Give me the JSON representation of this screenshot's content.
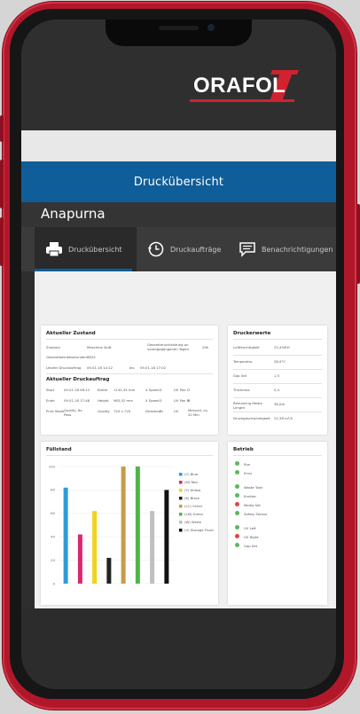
{
  "app": {
    "logo_text": "ORAFOL",
    "banner_title": "Druckübersicht",
    "machine_name": "Anapurna",
    "colors": {
      "banner": "#0f5d99",
      "logo_accent": "#d1222f",
      "phone_frame": "#b0182a"
    }
  },
  "tabs": [
    {
      "label": "Druckübersicht",
      "icon": "printer-icon",
      "active": true
    },
    {
      "label": "Druckaufträge",
      "icon": "history-clock-icon",
      "active": false
    },
    {
      "label": "Benachrichtigungen",
      "icon": "message-icon",
      "active": false
    }
  ],
  "status_card": {
    "title": "Aktueller Zustand",
    "rows": [
      {
        "label": "Zustand",
        "value": "Maschine läuft",
        "note": "Gesamtdruckleistung an vorangegangenen Tagen",
        "extra": "29h"
      },
      {
        "label": "Gesamtbetriebsstunden",
        "value": "8824"
      },
      {
        "label": "Letzter Druckauftrag",
        "value": "09.01.18 14:12",
        "mid": "bis",
        "value2": "09.01.18 17:02"
      }
    ],
    "job_title": "Aktueller Druckauftrag",
    "job_rows": [
      [
        "Start",
        "09.01.18 08:12",
        "Breite",
        "1142,34 mm",
        "X Speed",
        "4",
        "UV Pwr L",
        "7"
      ],
      [
        "Ende",
        "09.01.18 17:48",
        "Height",
        "963,02 mm",
        "X Speed",
        "3",
        "UV Pwr R",
        "6"
      ],
      [
        "Print Mode",
        "Quality, 8x Pass",
        "Quality",
        "720 x 720",
        "Direction",
        "Bi",
        "UV",
        "Manuell, ca. 20 Min"
      ]
    ]
  },
  "values_card": {
    "title": "Druckerwerte",
    "rows": [
      {
        "label": "Luftfeuchtigkeit",
        "value": "25,4%RH"
      },
      {
        "label": "Temperatur",
        "value": "28,9°C"
      },
      {
        "label": "Gap Set",
        "value": "1,5"
      },
      {
        "label": "Thickness",
        "value": "0,4"
      },
      {
        "label": "Remaining Media Length",
        "value": "36,0m"
      },
      {
        "label": "Druckgeschwindigkeit",
        "value": "22,38 m²/h"
      }
    ]
  },
  "fill_card": {
    "title": "Füllstand"
  },
  "chart_data": {
    "type": "bar",
    "title": "Füllstand",
    "ylim": [
      0,
      100
    ],
    "yticks": [
      100,
      80,
      60,
      40,
      20,
      0
    ],
    "series": [
      {
        "name": "(C) Blue",
        "value": 82,
        "color": "#2e9bd8"
      },
      {
        "name": "(M) Red",
        "value": 42,
        "color": "#d7286f"
      },
      {
        "name": "(Y) Yellow",
        "value": 62,
        "color": "#f3d21a"
      },
      {
        "name": "(K) Black",
        "value": 22,
        "color": "#222222"
      },
      {
        "name": "(LC) Ocher",
        "value": 100,
        "color": "#c99a4a"
      },
      {
        "name": "(LM) Green",
        "value": 100,
        "color": "#4fb548"
      },
      {
        "name": "(W) White",
        "value": 62,
        "color": "#bfbfbf"
      },
      {
        "name": "(V) Storage Flush",
        "value": 80,
        "color": "#111111"
      }
    ],
    "grid": true,
    "legend": "right"
  },
  "operation_card": {
    "title": "Betrieb",
    "items": [
      {
        "label": "Run",
        "color": "#5cb85c"
      },
      {
        "label": "Error",
        "color": "#5cb85c"
      },
      {
        "label": "Waste Tank",
        "color": "#5cb85c"
      },
      {
        "label": "Emitter",
        "color": "#5cb85c"
      },
      {
        "label": "Media Set",
        "color": "#e04545"
      },
      {
        "label": "Safety Sensor",
        "color": "#5cb85c"
      },
      {
        "label": "UV Left",
        "color": "#5cb85c"
      },
      {
        "label": "UV Right",
        "color": "#e04545"
      },
      {
        "label": "Gap Set",
        "color": "#5cb85c"
      }
    ]
  }
}
